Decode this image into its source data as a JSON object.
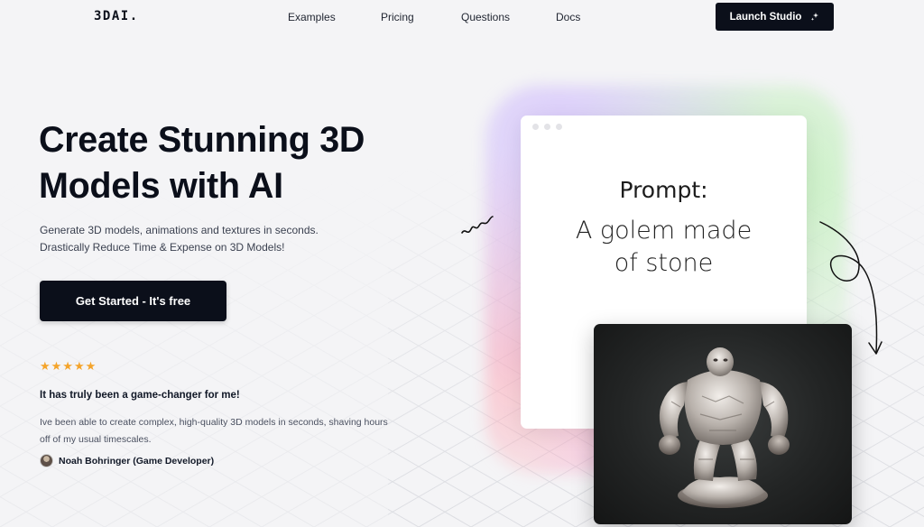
{
  "nav": {
    "logo": "3DAI.",
    "links": [
      "Examples",
      "Pricing",
      "Questions",
      "Docs"
    ],
    "cta_label": "Launch Studio",
    "cta_icon": "sparkle-icon"
  },
  "hero": {
    "title_lines": [
      "Create Stunning 3D",
      "Models with AI"
    ],
    "subtitle_lines": [
      "Generate 3D models, animations and textures in seconds.",
      "Drastically Reduce Time & Expense on 3D Models!"
    ],
    "cta_label": "Get Started - It's free"
  },
  "testimonial": {
    "stars": "★★★★★",
    "rating": 5,
    "title": "It has truly been a game-changer for me!",
    "body_lines": [
      "Ive been able to create complex, high-quality 3D models in seconds, shaving hours",
      "off of my usual timescales."
    ],
    "author": "Noah Bohringer (Game Developer)"
  },
  "showcase": {
    "prompt_label": "Prompt:",
    "prompt_lines": [
      "A golem made",
      "of stone"
    ]
  },
  "colors": {
    "background": "#f4f4f6",
    "primary_dark": "#0b0f1a",
    "star": "#f4a42b",
    "text_muted": "#3b4150"
  }
}
